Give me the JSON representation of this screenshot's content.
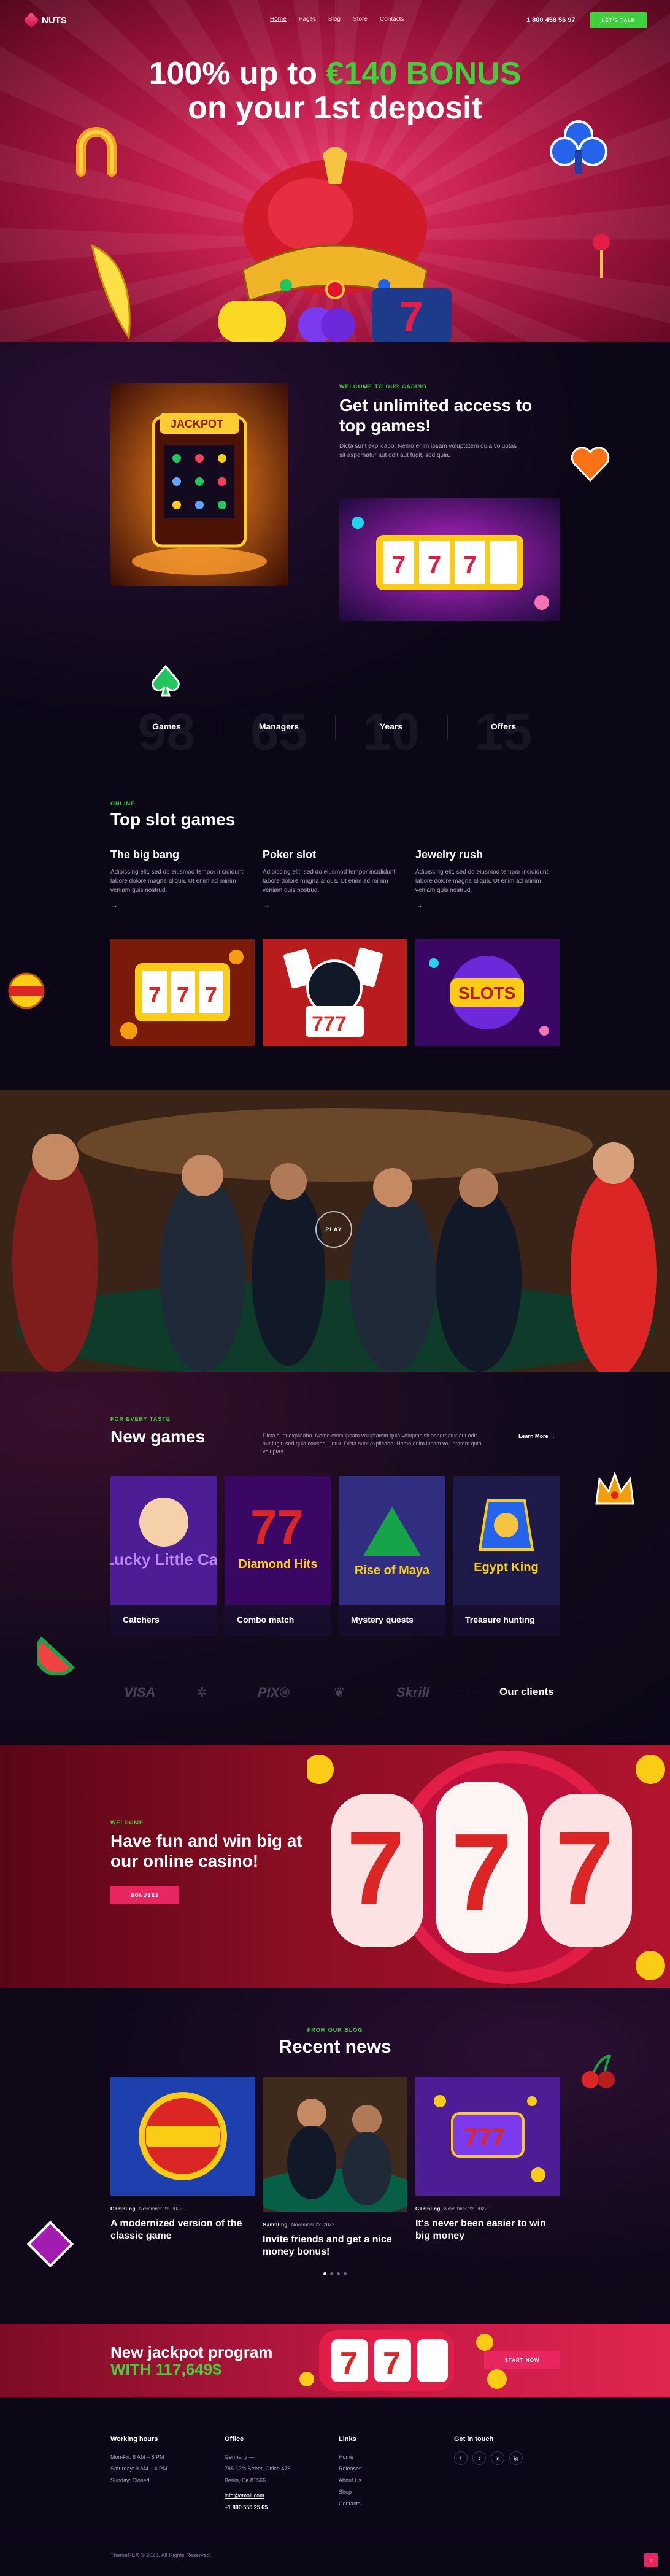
{
  "header": {
    "logo_text": "NUTS",
    "nav": [
      "Home",
      "Pages",
      "Blog",
      "Store",
      "Contacts"
    ],
    "phone": "1 800 458 56 97",
    "cta_label": "Let's talk"
  },
  "hero": {
    "line1_pre": "100% up to ",
    "line1_accent": "€140 BONUS",
    "line2": "on your 1st deposit"
  },
  "about": {
    "eyebrow": "Welcome to our casino",
    "title": "Get unlimited access to top games!",
    "text": "Dicta sunt explicabo. Nemo enim ipsam voluptatem quia voluptas sit aspernatur aut odit aut fugit, sed quia.",
    "stats": [
      {
        "num": "98",
        "label": "Games"
      },
      {
        "num": "65",
        "label": "Managers"
      },
      {
        "num": "10",
        "label": "Years"
      },
      {
        "num": "15",
        "label": "Offers"
      }
    ]
  },
  "slots": {
    "eyebrow": "Online",
    "title": "Top slot games",
    "items": [
      {
        "title": "The big bang",
        "text": "Adipiscing elit, sed do eiusmod tempor incididunt labore dolore magna aliqua. Ut enim ad minim veniam quis nostrud."
      },
      {
        "title": "Poker slot",
        "text": "Adipiscing elit, sed do eiusmod tempor incididunt labore dolore magna aliqua. Ut enim ad minim veniam quis nostrud."
      },
      {
        "title": "Jewelry rush",
        "text": "Adipiscing elit, sed do eiusmod tempor incididunt labore dolore magna aliqua. Ut enim ad minim veniam quis nostrud."
      }
    ],
    "arrow": "→"
  },
  "video": {
    "play_label": "PLAY"
  },
  "new_games": {
    "eyebrow": "For every taste",
    "title": "New games",
    "text": "Dicta sunt explicabo. Nemo enim ipsam voluptatem quia voluptas sit aspernatur aut odit aut fugit, sed quia consequuntur. Dicta sunt explicabo. Nemo enim ipsam voluptatem quia voluptas.",
    "learn_more": "Learn More →",
    "games": [
      {
        "name": "Catchers",
        "art": "Lucky Little Cat"
      },
      {
        "name": "Combo match",
        "art": "Diamond Hits"
      },
      {
        "name": "Mystery quests",
        "art": "Rise of Maya"
      },
      {
        "name": "Treasure hunting",
        "art": "Egypt King"
      }
    ],
    "clients": [
      "VISA",
      "✲",
      "PIX®",
      "❦",
      "Skrill"
    ],
    "clients_label": "Our clients"
  },
  "cta": {
    "eyebrow": "Welcome",
    "title": "Have fun and win big at our online casino!",
    "button": "Bonuses"
  },
  "news": {
    "eyebrow": "From our blog",
    "title": "Recent news",
    "items": [
      {
        "category": "Gambling",
        "date": "November 22, 2022",
        "title": "A modernized version of the classic game"
      },
      {
        "category": "Gambling",
        "date": "November 22, 2022",
        "title": "Invite friends and get a nice money bonus!"
      },
      {
        "category": "Gambling",
        "date": "November 22, 2022",
        "title": "It's never been easier to win big money"
      }
    ]
  },
  "jackpot": {
    "line1": "New jackpot program",
    "line2": "WITH 117,649$",
    "button": "Start now"
  },
  "footer": {
    "hours_title": "Working hours",
    "hours": [
      "Mon-Fri: 8 AM – 8 PM",
      "Saturday: 9 AM – 4 PM",
      "Sunday: Closed"
    ],
    "office_title": "Office",
    "office": [
      "Germany —",
      "785 12th Street, Office 478",
      "Berlin, De 81566",
      "info@email.com",
      "+1 800 555 25 65"
    ],
    "links_title": "Links",
    "links": [
      "Home",
      "Releases",
      "About Us",
      "Shop",
      "Contacts"
    ],
    "touch_title": "Get in touch",
    "social": [
      "f",
      "t",
      "in",
      "ig"
    ],
    "copyright": "ThemeREX © 2023. All Rights Reserved.",
    "to_top": "↑"
  },
  "colors": {
    "accent_pink": "#e8265f",
    "accent_green": "#3fd13c"
  }
}
